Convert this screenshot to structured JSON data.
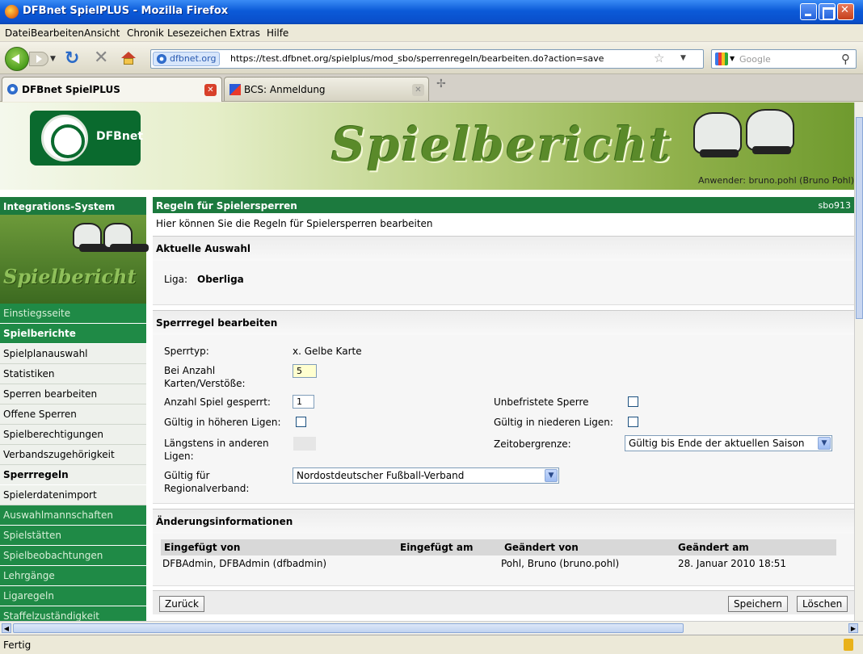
{
  "window": {
    "title": "DFBnet SpielPLUS - Mozilla Firefox"
  },
  "menu": [
    "Datei",
    "Bearbeiten",
    "Ansicht",
    "Chronik",
    "Lesezeichen",
    "Extras",
    "Hilfe"
  ],
  "nav": {
    "site_badge": "dfbnet.org",
    "url": "https://test.dfbnet.org/spielplus/mod_sbo/sperrenregeln/bearbeiten.do?action=save",
    "search_placeholder": "Google"
  },
  "tabs": [
    {
      "label": "DFBnet SpielPLUS",
      "active": true
    },
    {
      "label": "BCS: Anmeldung",
      "active": false
    }
  ],
  "header": {
    "logo_text": "DFBnet",
    "banner": "Spielbericht",
    "user": "Anwender: bruno.pohl (Bruno Pohl)"
  },
  "sidebar": {
    "heading": "Integrations-System",
    "image_title": "Spielbericht",
    "items": [
      {
        "label": "Einstiegsseite"
      },
      {
        "label": "Spielberichte"
      },
      {
        "label": "Spielplanauswahl"
      },
      {
        "label": "Statistiken"
      },
      {
        "label": "Sperren bearbeiten"
      },
      {
        "label": "Offene Sperren"
      },
      {
        "label": "Spielberechtigungen"
      },
      {
        "label": "Verbandszugehörigkeit"
      },
      {
        "label": "Sperrregeln"
      },
      {
        "label": "Spielerdatenimport"
      },
      {
        "label": "Auswahlmannschaften"
      },
      {
        "label": "Spielstätten"
      },
      {
        "label": "Spielbeobachtungen"
      },
      {
        "label": "Lehrgänge"
      },
      {
        "label": "Ligaregeln"
      },
      {
        "label": "Staffelzuständigkeit"
      }
    ]
  },
  "main": {
    "title": "Regeln für Spielersperren",
    "code": "sbo913",
    "subtitle": "Hier können Sie die Regeln für Spielersperren bearbeiten",
    "selection": {
      "title": "Aktuelle Auswahl",
      "liga_label": "Liga:",
      "liga_value": "Oberliga"
    },
    "edit": {
      "title": "Sperrregel bearbeiten",
      "sperrtyp_label": "Sperrtyp:",
      "sperrtyp_value": "x. Gelbe Karte",
      "anzahl_karten_label": "Bei Anzahl Karten/Verstöße:",
      "anzahl_karten_value": "5",
      "anzahl_spiel_label": "Anzahl Spiel gesperrt:",
      "anzahl_spiel_value": "1",
      "unbefristet_label": "Unbefristete Sperre",
      "hoehere_label": "Gültig in höheren Ligen:",
      "niedere_label": "Gültig in niederen Ligen:",
      "laengstens_label": "Längstens in anderen Ligen:",
      "zeitober_label": "Zeitobergrenze:",
      "zeitober_value": "Gültig bis Ende der aktuellen Saison",
      "regional_label": "Gültig für Regionalverband:",
      "regional_value": "Nordostdeutscher Fußball-Verband"
    },
    "changes": {
      "title": "Änderungsinformationen",
      "headers": [
        "Eingefügt von",
        "Eingefügt am",
        "Geändert von",
        "Geändert am"
      ],
      "row": [
        "DFBAdmin, DFBAdmin (dfbadmin)",
        "",
        "Pohl, Bruno (bruno.pohl)",
        "28. Januar 2010 18:51"
      ]
    },
    "buttons": {
      "back": "Zurück",
      "save": "Speichern",
      "delete": "Löschen"
    }
  },
  "status": "Fertig"
}
